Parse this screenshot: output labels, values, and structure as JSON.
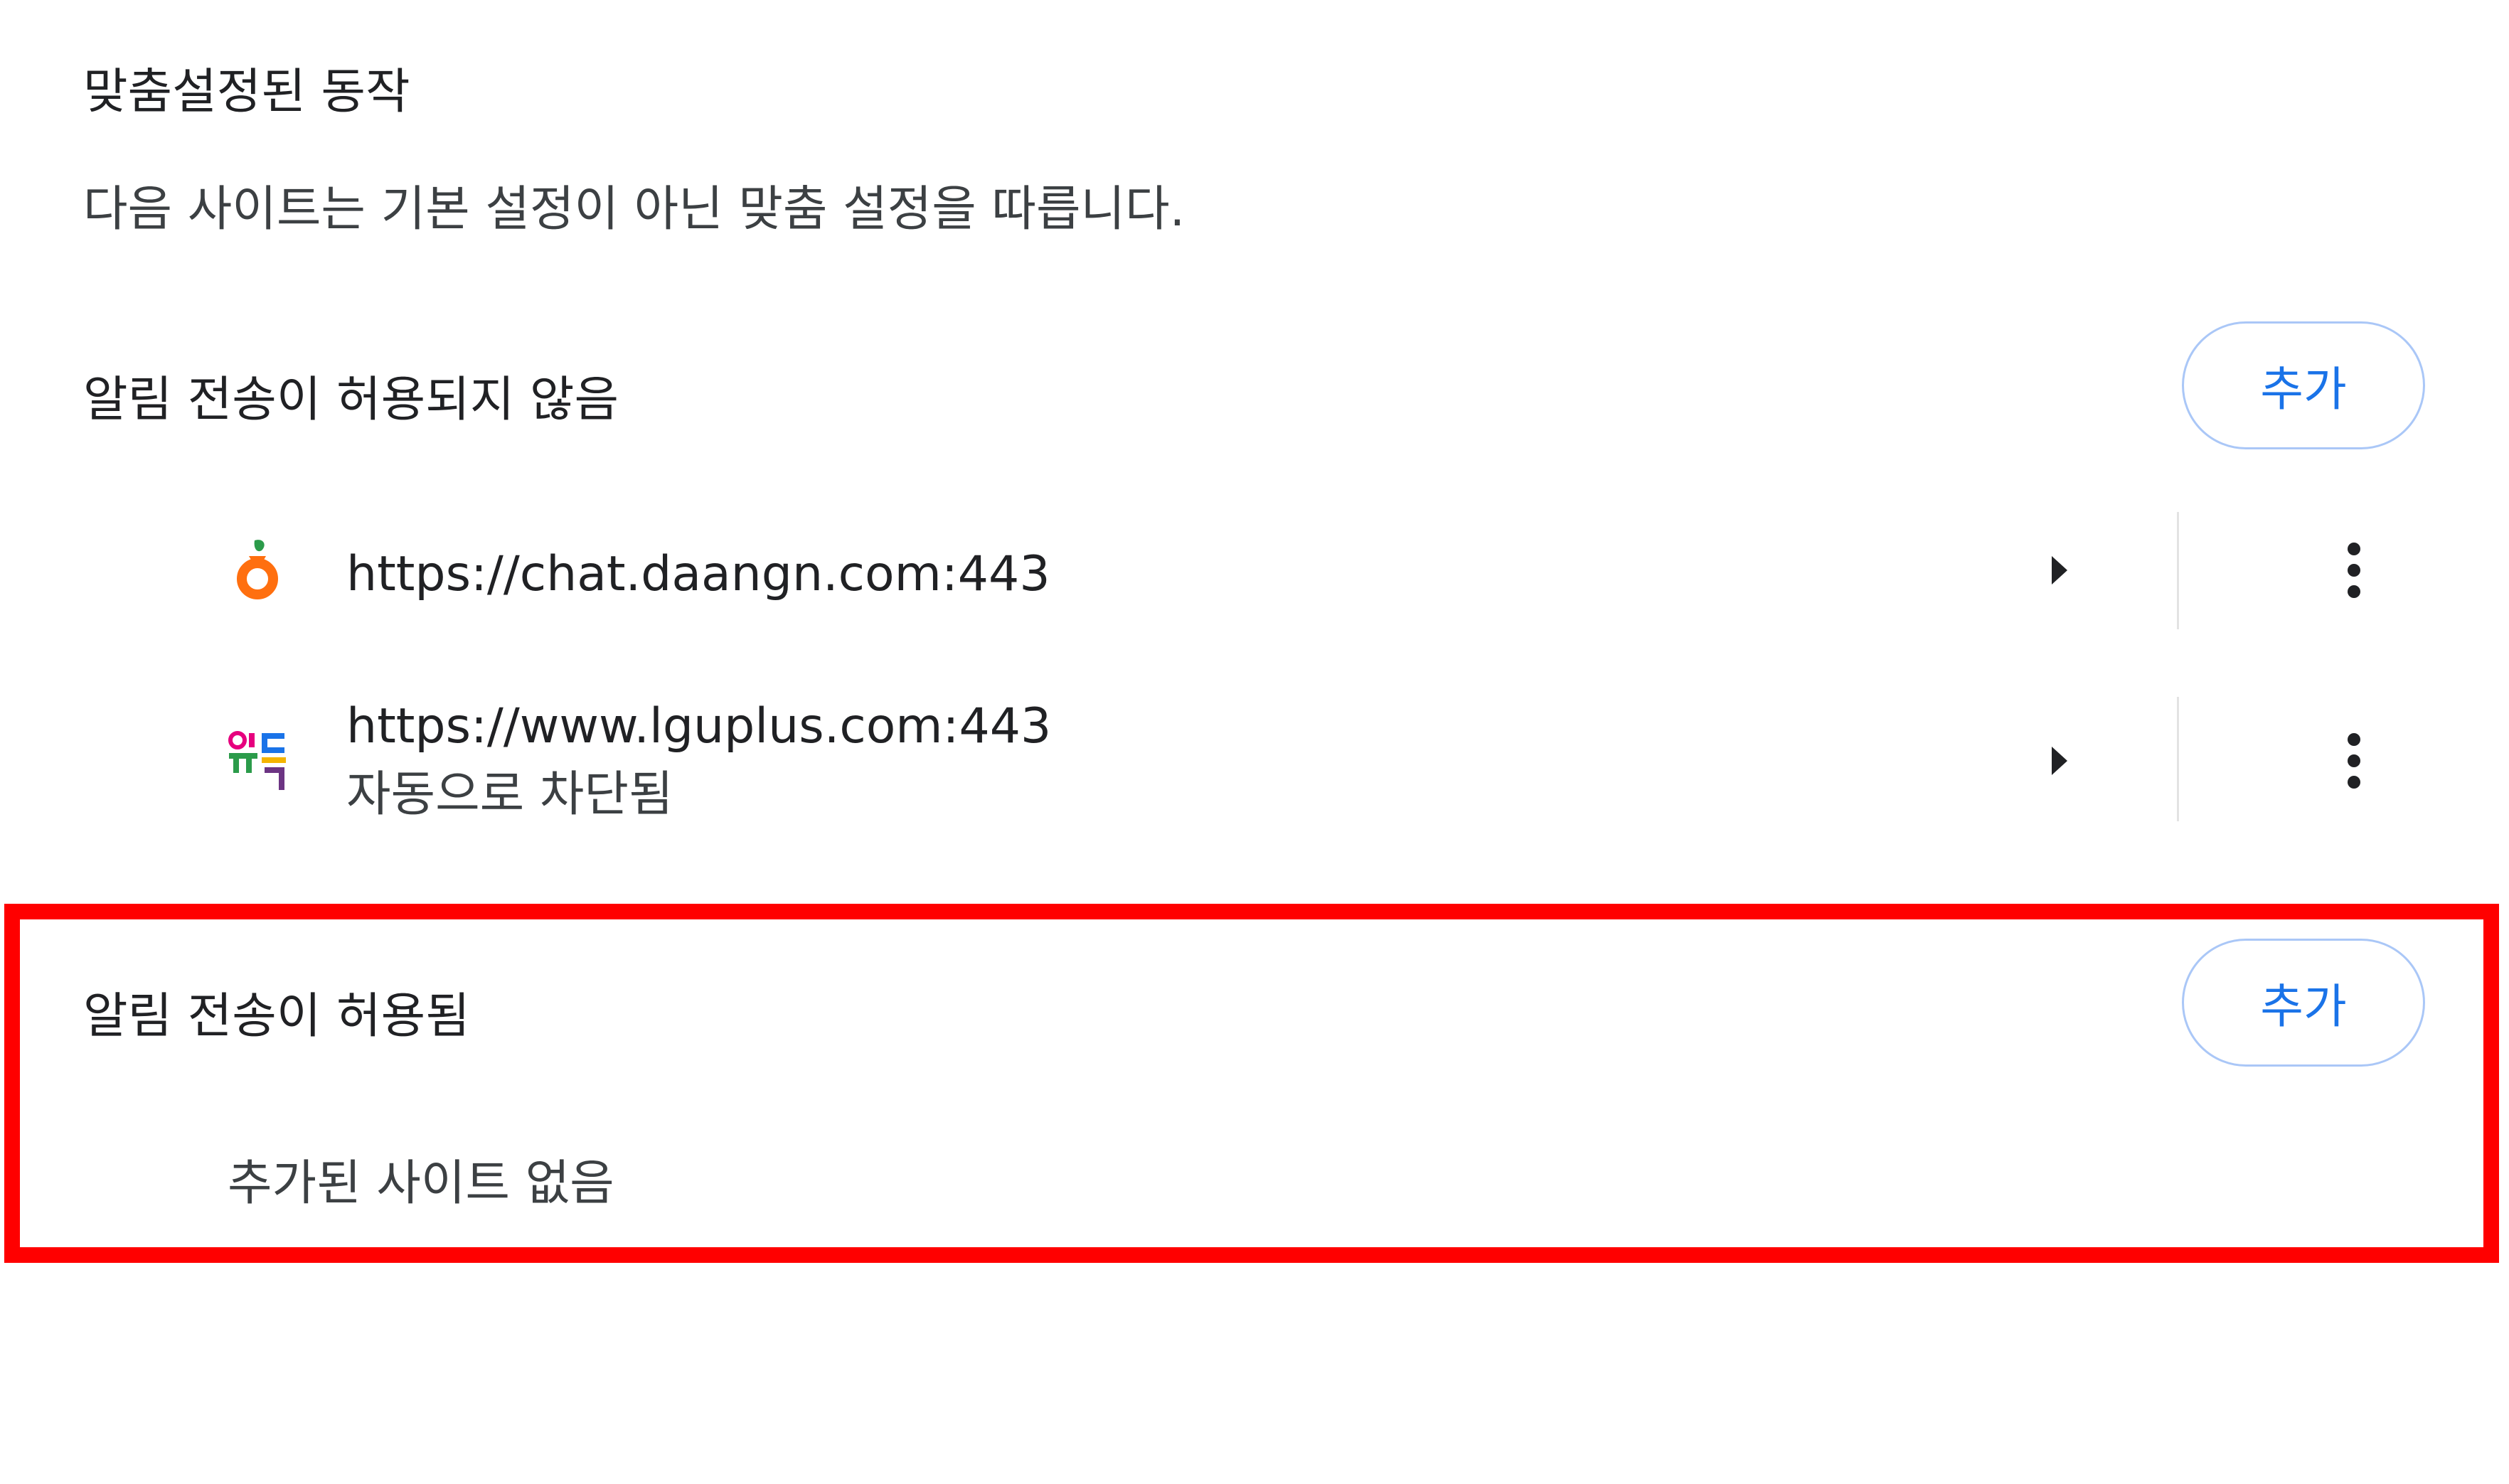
{
  "section": {
    "title": "맞춤설정된 동작",
    "description": "다음 사이트는 기본 설정이 아닌 맞춤 설정을 따릅니다."
  },
  "blocked": {
    "label": "알림 전송이 허용되지 않음",
    "add_label": "추가",
    "sites": [
      {
        "url": "https://chat.daangn.com:443",
        "icon": "daangn-carrot-icon",
        "subtitle": ""
      },
      {
        "url": "https://www.lguplus.com:443",
        "icon": "lguplus-udok-icon",
        "subtitle": "자동으로 차단됨"
      }
    ]
  },
  "allowed": {
    "label": "알림 전송이 허용됨",
    "add_label": "추가",
    "empty_text": "추가된 사이트 없음"
  },
  "colors": {
    "accent": "#1a73e8",
    "highlight": "#ff0000",
    "carrot_orange": "#ff6f0f",
    "carrot_green": "#2b9b4a"
  }
}
